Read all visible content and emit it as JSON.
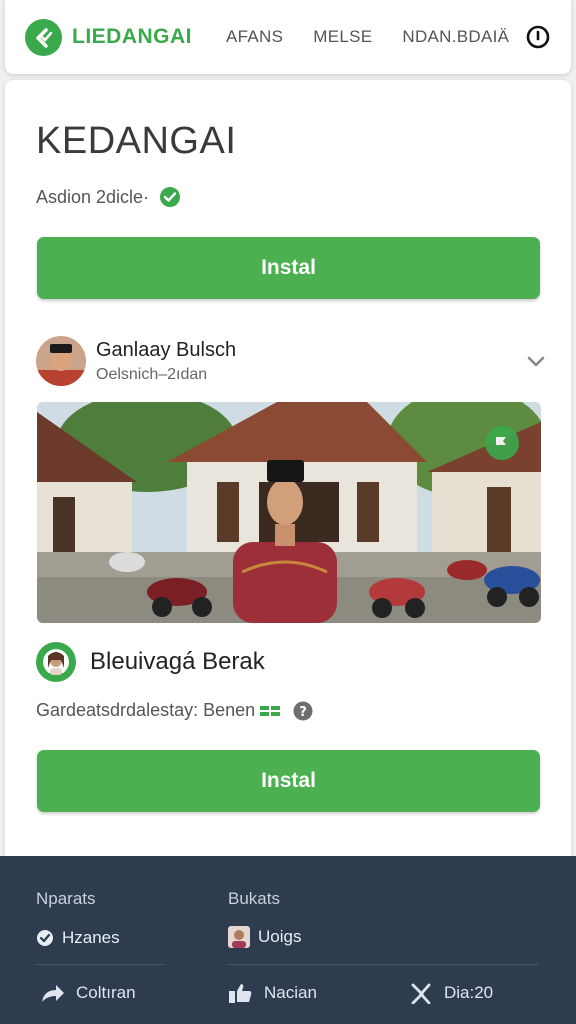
{
  "nav": {
    "brand": "LIEDANGAI",
    "links": [
      "AFANS",
      "MELSE",
      "NDAN.BDAIÄ"
    ]
  },
  "main": {
    "title": "KEDANGAI",
    "subtitle": "Asdion 2dicle·",
    "install_label": "Instal",
    "author": {
      "name": "Ganlaay Bulsch",
      "sub": "Oelsnich–2ıdan"
    },
    "profile2_name": "Bleuivagá Berak",
    "meta_text": "Gardeatsdrdalestay: Benen",
    "install2_label": "Instal"
  },
  "footer": {
    "col1_heading": "Nparats",
    "col1_item": "Hzanes",
    "col2_heading": "Bukats",
    "col2_item": "Uoigs",
    "links": [
      "Coltıran",
      "Nacian",
      "Dia:20"
    ]
  },
  "colors": {
    "brand_green": "#3aa94b",
    "button_green": "#4caf50",
    "footer_bg": "#2f3b4f"
  },
  "icons": {
    "logo": "back-check-icon",
    "power": "power-icon",
    "verified": "check-circle-icon",
    "chevron": "chevron-down-icon",
    "help": "question-circle-icon",
    "share": "share-arrow-icon",
    "like": "thumbs-up-icon",
    "close": "x-icon"
  }
}
